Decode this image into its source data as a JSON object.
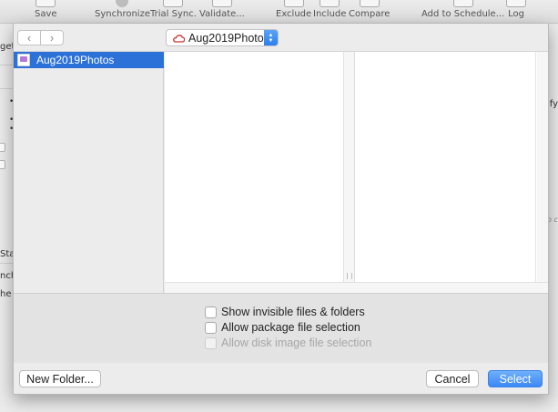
{
  "toolbar": {
    "items": [
      {
        "label": "Save",
        "icon": "save-icon"
      },
      {
        "label": "Synchronize",
        "icon": "synchronize-icon"
      },
      {
        "label": "Trial Sync.",
        "icon": "trial-sync-icon"
      },
      {
        "label": "Validate...",
        "icon": "validate-icon"
      },
      {
        "label": "Exclude",
        "icon": "exclude-icon"
      },
      {
        "label": "Include",
        "icon": "include-icon"
      },
      {
        "label": "Compare",
        "icon": "compare-icon"
      },
      {
        "label": "Add to Schedule...",
        "icon": "schedule-icon"
      },
      {
        "label": "Log",
        "icon": "log-icon"
      }
    ]
  },
  "background": {
    "frag_get": "get",
    "frag_ify": "ify",
    "frag_sta": "Sta",
    "frag_nch": "nch",
    "frag_he": "he",
    "frag_oc": "o ch"
  },
  "panel": {
    "nav": {
      "back": "‹",
      "forward": "›"
    },
    "location": "Aug2019Photos",
    "sidebar": {
      "items": [
        {
          "label": "Aug2019Photos",
          "icon": "disk-image-icon",
          "selected": true
        }
      ]
    },
    "options": {
      "show_invisible": {
        "label": "Show invisible files & folders",
        "checked": false,
        "enabled": true
      },
      "allow_package": {
        "label": "Allow package file selection",
        "checked": false,
        "enabled": true
      },
      "allow_disk_image": {
        "label": "Allow disk image file selection",
        "checked": false,
        "enabled": false
      }
    },
    "buttons": {
      "new_folder": "New Folder...",
      "cancel": "Cancel",
      "select": "Select"
    }
  },
  "colors": {
    "accent": "#2b71d8",
    "primary_button": "#3c88f5",
    "popup_arrow": "#2a7ff0",
    "cloud": "#d0312d"
  }
}
